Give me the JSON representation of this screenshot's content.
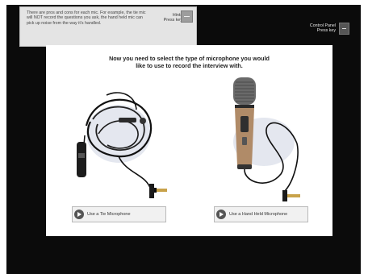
{
  "hint": {
    "text": "There are pros and cons for each mic. For example, the tie mic will NOT record the questions you ask, the hand held mic can pick up noise from the way it's handled.",
    "label": "Hints",
    "key": "Press key"
  },
  "control_panel": {
    "label": "Control Panel",
    "key": "Press key"
  },
  "prompt": {
    "line1": "Now you need to select the type of microphone you would",
    "line2": "like to use to record the interview with."
  },
  "options": [
    {
      "label": "Use a Tie Microphone",
      "icon": "play-icon"
    },
    {
      "label": "Use a Hand Held Microphone",
      "icon": "play-icon"
    }
  ],
  "colors": {
    "frame": "#0b0b0b",
    "panel": "#ffffff",
    "hint_bg": "#e4e4e4"
  }
}
